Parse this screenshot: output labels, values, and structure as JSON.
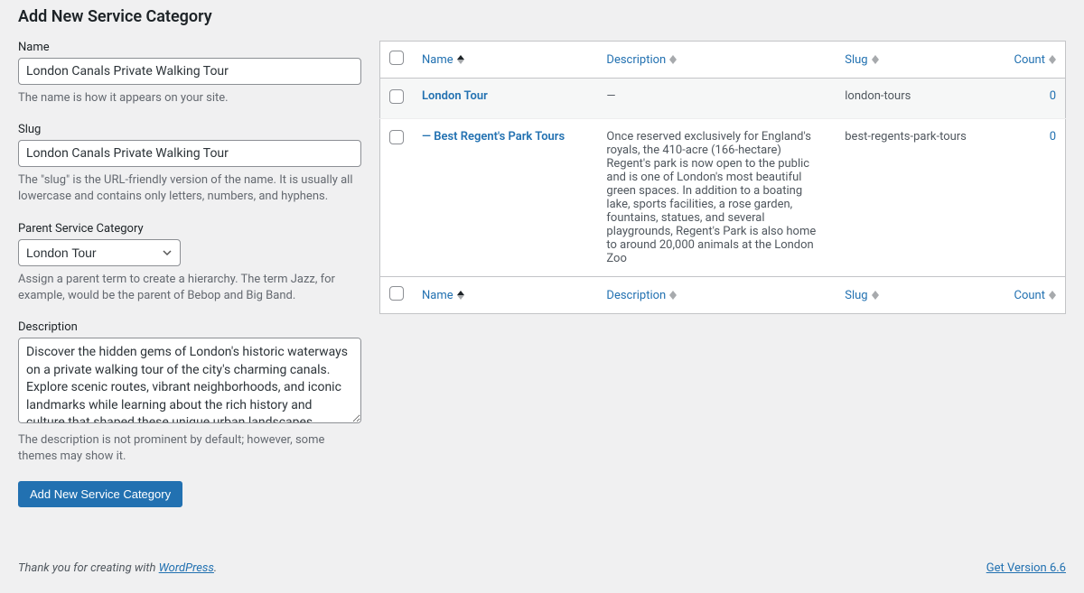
{
  "page": {
    "title": "Add New Service Category"
  },
  "form": {
    "name": {
      "label": "Name",
      "value": "London Canals Private Walking Tour",
      "help": "The name is how it appears on your site."
    },
    "slug": {
      "label": "Slug",
      "value": "London Canals Private Walking Tour",
      "help": "The \"slug\" is the URL-friendly version of the name. It is usually all lowercase and contains only letters, numbers, and hyphens."
    },
    "parent": {
      "label": "Parent Service Category",
      "selected": "London Tour",
      "help": "Assign a parent term to create a hierarchy. The term Jazz, for example, would be the parent of Bebop and Big Band."
    },
    "description": {
      "label": "Description",
      "value": "Discover the hidden gems of London's historic waterways on a private walking tour of the city's charming canals. Explore scenic routes, vibrant neighborhoods, and iconic landmarks while learning about the rich history and culture that shaped these unique urban landscapes. Perfect for those seeking a",
      "help": "The description is not prominent by default; however, some themes may show it."
    },
    "submit": "Add New Service Category"
  },
  "table": {
    "columns": {
      "name": "Name",
      "description": "Description",
      "slug": "Slug",
      "count": "Count"
    },
    "rows": [
      {
        "name": "London Tour",
        "description": "—",
        "slug": "london-tours",
        "count": "0"
      },
      {
        "name": "— Best Regent's Park Tours",
        "description": "Once reserved exclusively for England's royals, the 410-acre (166-hectare) Regent's park is now open to the public and is one of London's most beautiful green spaces. In addition to a boating lake, sports facilities, a rose garden, fountains, statues, and several playgrounds, Regent's Park is also home to around 20,000 animals at the London Zoo",
        "slug": "best-regents-park-tours",
        "count": "0"
      }
    ]
  },
  "footer": {
    "thanks_prefix": "Thank you for creating with ",
    "thanks_link": "WordPress",
    "thanks_suffix": ".",
    "version": "Get Version 6.6"
  }
}
